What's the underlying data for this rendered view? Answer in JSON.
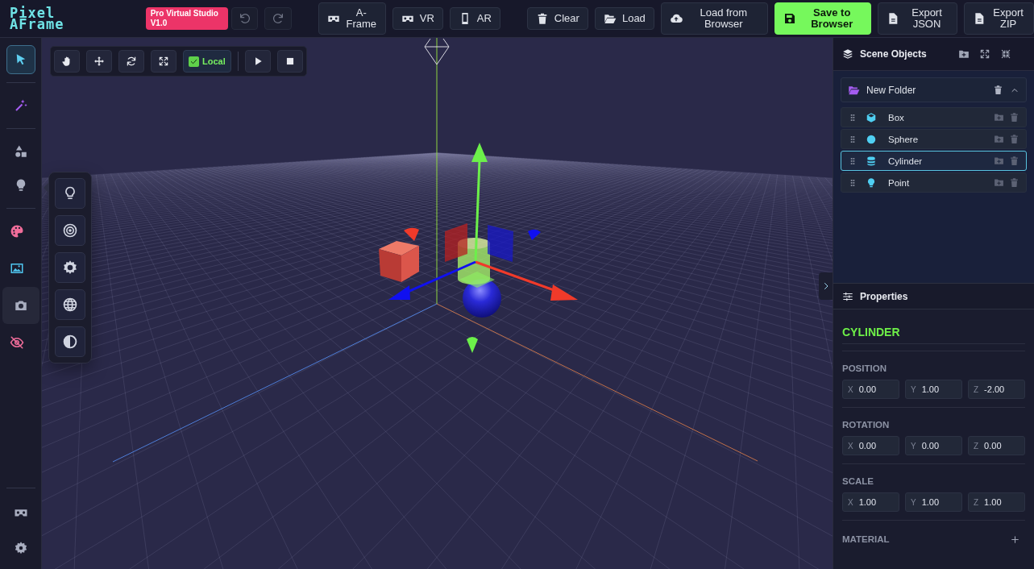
{
  "logo": {
    "lines": [
      "Pixel",
      "AFrame"
    ]
  },
  "version_badge": "Pro Virtual Studio V1.0",
  "header_buttons": [
    {
      "label": "A-Frame",
      "kind": "vr",
      "primary": false
    },
    {
      "label": "VR",
      "kind": "vr",
      "primary": false
    },
    {
      "label": "AR",
      "kind": "mobile",
      "primary": false
    },
    {
      "label": "Clear",
      "kind": "trash",
      "primary": false
    },
    {
      "label": "Load",
      "kind": "folder",
      "primary": false
    },
    {
      "label": "Load from Browser",
      "kind": "cloud",
      "primary": false
    },
    {
      "label": "Save to Browser",
      "kind": "save",
      "primary": true
    },
    {
      "label": "Export JSON",
      "kind": "file",
      "primary": false
    },
    {
      "label": "Export ZIP",
      "kind": "file",
      "primary": false
    }
  ],
  "toolbar": {
    "tools": [
      {
        "kind": "hand",
        "selected": false
      },
      {
        "kind": "move",
        "selected": false
      },
      {
        "kind": "rotate",
        "selected": false
      },
      {
        "kind": "scale",
        "selected": false
      }
    ],
    "local": {
      "label": "Local",
      "checked": true
    }
  },
  "sidebar": {
    "groups": [
      [
        {
          "kind": "cursor",
          "selected": true,
          "hovered": false
        }
      ],
      [
        {
          "kind": "wand",
          "selected": false,
          "hovered": false
        }
      ],
      [
        {
          "kind": "shapes",
          "selected": false,
          "hovered": false
        },
        {
          "kind": "bulb",
          "selected": false,
          "hovered": false
        }
      ],
      [
        {
          "kind": "palette",
          "selected": false,
          "hovered": false
        },
        {
          "kind": "image",
          "selected": false,
          "hovered": false
        },
        {
          "kind": "camera",
          "selected": false,
          "hovered": true
        },
        {
          "kind": "eyeslash",
          "selected": false,
          "hovered": false
        }
      ]
    ],
    "bottom": [
      {
        "kind": "vr",
        "selected": false,
        "hovered": false
      },
      {
        "kind": "gear",
        "selected": false,
        "hovered": false
      }
    ]
  },
  "light_menu": {
    "items": [
      {
        "kind": "bulbline"
      },
      {
        "kind": "target"
      },
      {
        "kind": "sun"
      },
      {
        "kind": "globe"
      },
      {
        "kind": "contrast"
      }
    ]
  },
  "scene_objects": {
    "title": "Scene Objects",
    "folder": {
      "name": "New Folder",
      "expanded": true
    },
    "items": [
      {
        "name": "Box",
        "kind": "cube",
        "selected": false
      },
      {
        "name": "Sphere",
        "kind": "circle",
        "selected": false
      },
      {
        "name": "Cylinder",
        "kind": "stack",
        "selected": true
      },
      {
        "name": "Point",
        "kind": "bulb",
        "selected": false
      }
    ]
  },
  "properties": {
    "title": "Properties",
    "object": "CYLINDER",
    "sections": [
      {
        "title": "POSITION",
        "fields": [
          {
            "axis": "X",
            "value": "0.00"
          },
          {
            "axis": "Y",
            "value": "1.00"
          },
          {
            "axis": "Z",
            "value": "-2.00"
          }
        ]
      },
      {
        "title": "ROTATION",
        "fields": [
          {
            "axis": "X",
            "value": "0.00"
          },
          {
            "axis": "Y",
            "value": "0.00"
          },
          {
            "axis": "Z",
            "value": "0.00"
          }
        ]
      },
      {
        "title": "SCALE",
        "fields": [
          {
            "axis": "X",
            "value": "1.00"
          },
          {
            "axis": "Y",
            "value": "1.00"
          },
          {
            "axis": "Z",
            "value": "1.00"
          }
        ]
      }
    ],
    "material": {
      "title": "MATERIAL",
      "expanded": false
    }
  }
}
